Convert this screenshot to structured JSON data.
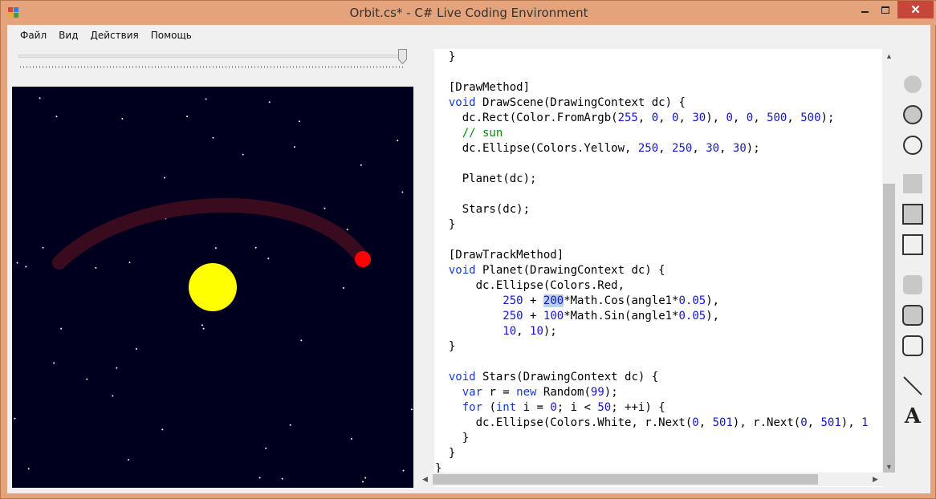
{
  "window": {
    "title": "Orbit.cs* - C# Live Coding Environment",
    "controls": {
      "minimize": "minimize-icon",
      "maximize": "maximize-icon",
      "close": "✕"
    },
    "frame_color": "#e4a37a",
    "close_color": "#c7463a"
  },
  "menu": {
    "items": [
      {
        "label": "Файл"
      },
      {
        "label": "Вид"
      },
      {
        "label": "Действия"
      },
      {
        "label": "Помощь"
      }
    ]
  },
  "slider": {
    "value": 1.0
  },
  "scene": {
    "background": "#00001e",
    "sun_color": "#ffff00",
    "planet_color": "#ff0000",
    "track_color": "#3a0a1e"
  },
  "editor": {
    "lines": [
      [
        {
          "t": "  }"
        }
      ],
      [
        {
          "t": ""
        }
      ],
      [
        {
          "t": "  [DrawMethod]"
        }
      ],
      [
        {
          "t": "  "
        },
        {
          "t": "void",
          "c": "kw"
        },
        {
          "t": " DrawScene(DrawingContext dc) {"
        }
      ],
      [
        {
          "t": "    dc.Rect(Color.FromArgb("
        },
        {
          "t": "255",
          "c": "num"
        },
        {
          "t": ", "
        },
        {
          "t": "0",
          "c": "num"
        },
        {
          "t": ", "
        },
        {
          "t": "0",
          "c": "num"
        },
        {
          "t": ", "
        },
        {
          "t": "30",
          "c": "num"
        },
        {
          "t": "), "
        },
        {
          "t": "0",
          "c": "num"
        },
        {
          "t": ", "
        },
        {
          "t": "0",
          "c": "num"
        },
        {
          "t": ", "
        },
        {
          "t": "500",
          "c": "num"
        },
        {
          "t": ", "
        },
        {
          "t": "500",
          "c": "num"
        },
        {
          "t": ");"
        }
      ],
      [
        {
          "t": "    "
        },
        {
          "t": "// sun",
          "c": "cmt"
        }
      ],
      [
        {
          "t": "    dc.Ellipse(Colors.Yellow, "
        },
        {
          "t": "250",
          "c": "num"
        },
        {
          "t": ", "
        },
        {
          "t": "250",
          "c": "num"
        },
        {
          "t": ", "
        },
        {
          "t": "30",
          "c": "num"
        },
        {
          "t": ", "
        },
        {
          "t": "30",
          "c": "num"
        },
        {
          "t": ");"
        }
      ],
      [
        {
          "t": ""
        }
      ],
      [
        {
          "t": "    Planet(dc);"
        }
      ],
      [
        {
          "t": ""
        }
      ],
      [
        {
          "t": "    Stars(dc);"
        }
      ],
      [
        {
          "t": "  }"
        }
      ],
      [
        {
          "t": ""
        }
      ],
      [
        {
          "t": "  [DrawTrackMethod]"
        }
      ],
      [
        {
          "t": "  "
        },
        {
          "t": "void",
          "c": "kw"
        },
        {
          "t": " Planet(DrawingContext dc) {"
        }
      ],
      [
        {
          "t": "      dc.Ellipse(Colors.Red,"
        }
      ],
      [
        {
          "t": "          "
        },
        {
          "t": "250",
          "c": "num"
        },
        {
          "t": " + "
        },
        {
          "t": "200",
          "c": "num sel"
        },
        {
          "t": "*Math.Cos(angle1*"
        },
        {
          "t": "0.05",
          "c": "num"
        },
        {
          "t": "),"
        }
      ],
      [
        {
          "t": "          "
        },
        {
          "t": "250",
          "c": "num"
        },
        {
          "t": " + "
        },
        {
          "t": "100",
          "c": "num"
        },
        {
          "t": "*Math.Sin(angle1*"
        },
        {
          "t": "0.05",
          "c": "num"
        },
        {
          "t": "),"
        }
      ],
      [
        {
          "t": "          "
        },
        {
          "t": "10",
          "c": "num"
        },
        {
          "t": ", "
        },
        {
          "t": "10",
          "c": "num"
        },
        {
          "t": ");"
        }
      ],
      [
        {
          "t": "  }"
        }
      ],
      [
        {
          "t": ""
        }
      ],
      [
        {
          "t": "  "
        },
        {
          "t": "void",
          "c": "kw"
        },
        {
          "t": " Stars(DrawingContext dc) {"
        }
      ],
      [
        {
          "t": "    "
        },
        {
          "t": "var",
          "c": "kw"
        },
        {
          "t": " r = "
        },
        {
          "t": "new",
          "c": "kw"
        },
        {
          "t": " Random("
        },
        {
          "t": "99",
          "c": "num"
        },
        {
          "t": ");"
        }
      ],
      [
        {
          "t": "    "
        },
        {
          "t": "for",
          "c": "kw"
        },
        {
          "t": " ("
        },
        {
          "t": "int",
          "c": "kw"
        },
        {
          "t": " i = "
        },
        {
          "t": "0",
          "c": "num"
        },
        {
          "t": "; i < "
        },
        {
          "t": "50",
          "c": "num"
        },
        {
          "t": "; ++i) {"
        }
      ],
      [
        {
          "t": "      dc.Ellipse(Colors.White, r.Next("
        },
        {
          "t": "0",
          "c": "num"
        },
        {
          "t": ", "
        },
        {
          "t": "501",
          "c": "num"
        },
        {
          "t": "), r.Next("
        },
        {
          "t": "0",
          "c": "num"
        },
        {
          "t": ", "
        },
        {
          "t": "501",
          "c": "num"
        },
        {
          "t": "), "
        },
        {
          "t": "1",
          "c": "num"
        }
      ],
      [
        {
          "t": "    }"
        }
      ],
      [
        {
          "t": "  }"
        }
      ],
      [
        {
          "t": "}"
        }
      ]
    ]
  },
  "scroll": {
    "up": "▲",
    "down": "▼",
    "left": "◀",
    "right": "▶"
  },
  "tools": [
    {
      "icon": "filled-circle-tool-icon"
    },
    {
      "icon": "filled-outlined-circle-tool-icon"
    },
    {
      "icon": "outlined-circle-tool-icon"
    },
    {
      "icon": "filled-rect-tool-icon"
    },
    {
      "icon": "filled-outlined-rect-tool-icon"
    },
    {
      "icon": "outlined-rect-tool-icon"
    },
    {
      "icon": "filled-rounded-rect-tool-icon"
    },
    {
      "icon": "filled-outlined-rounded-rect-tool-icon"
    },
    {
      "icon": "outlined-rounded-rect-tool-icon"
    },
    {
      "icon": "line-tool-icon"
    },
    {
      "icon": "text-tool-icon",
      "label": "A"
    }
  ]
}
